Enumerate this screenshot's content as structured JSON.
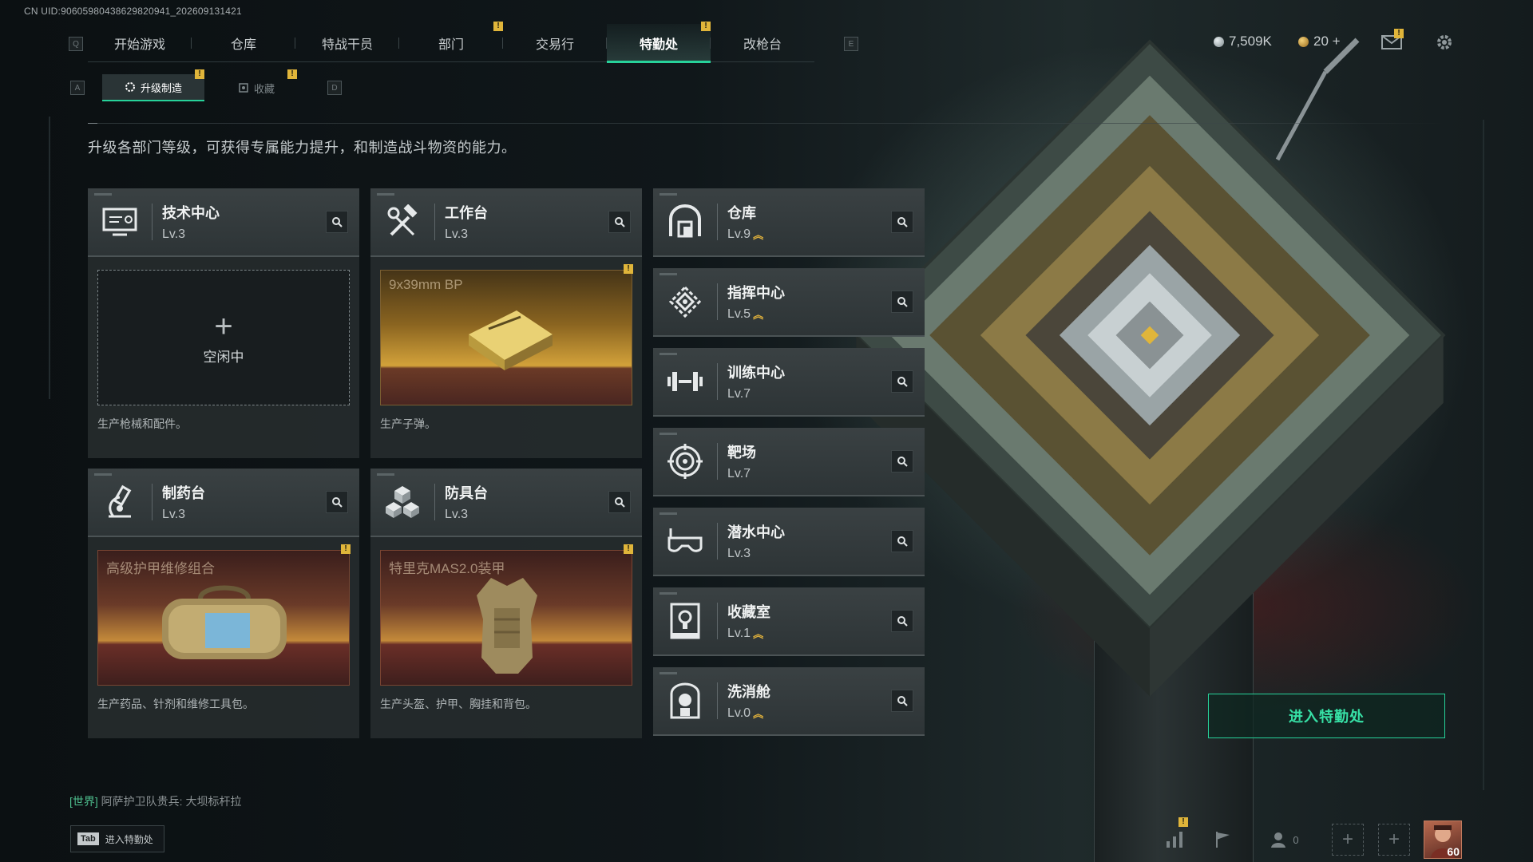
{
  "uid_text": "CN UID:9060598043862982094​1_202609131421",
  "nav": {
    "key_left": "Q",
    "key_right": "E",
    "tabs": [
      {
        "label": "开始游戏"
      },
      {
        "label": "仓库"
      },
      {
        "label": "特战干员"
      },
      {
        "label": "部门"
      },
      {
        "label": "交易行"
      },
      {
        "label": "特勤处"
      },
      {
        "label": "改枪台"
      }
    ],
    "active_tab": "特勤处"
  },
  "currency": {
    "silver": "7,509K",
    "gold": "20 +"
  },
  "subtabs": {
    "key_left": "A",
    "key_right": "D",
    "upgrade_label": "升级制造",
    "collect_label": "收藏"
  },
  "description": "升级各部门等级，可获得专属能力提升，和制造战斗物资的能力。",
  "workshops": [
    {
      "name": "技术中心",
      "level": "Lv.3",
      "icon": "computer-icon",
      "slot": {
        "state": "idle",
        "plus": "+",
        "label": "空闲中"
      },
      "caption": "生产枪械和配件。"
    },
    {
      "name": "工作台",
      "level": "Lv.3",
      "icon": "tools-icon",
      "slot": {
        "state": "producing",
        "item": "9x39mm BP"
      },
      "caption": "生产子弹。"
    },
    {
      "name": "制药台",
      "level": "Lv.3",
      "icon": "microscope-icon",
      "slot": {
        "state": "producing",
        "item": "高级护甲维修组合"
      },
      "caption": "生产药品、针剂和维修工具包。"
    },
    {
      "name": "防具台",
      "level": "Lv.3",
      "icon": "cubes-icon",
      "slot": {
        "state": "producing",
        "item": "特里克MAS2.0装甲"
      },
      "caption": "生产头盔、护甲、胸挂和背包。"
    }
  ],
  "departments": [
    {
      "name": "仓库",
      "level": "Lv.9",
      "upgradable": true,
      "icon": "vault-icon"
    },
    {
      "name": "指挥中心",
      "level": "Lv.5",
      "upgradable": true,
      "icon": "command-icon"
    },
    {
      "name": "训练中心",
      "level": "Lv.7",
      "upgradable": false,
      "icon": "dumbbell-icon"
    },
    {
      "name": "靶场",
      "level": "Lv.7",
      "upgradable": false,
      "icon": "target-icon"
    },
    {
      "name": "潜水中心",
      "level": "Lv.3",
      "upgradable": false,
      "icon": "diving-mask-icon"
    },
    {
      "name": "收藏室",
      "level": "Lv.1",
      "upgradable": true,
      "icon": "trophy-case-icon"
    },
    {
      "name": "洗消舱",
      "level": "Lv.0",
      "upgradable": true,
      "icon": "hazmat-icon"
    }
  ],
  "upgrade_glyph": "︽",
  "alert_glyph": "!",
  "enter_button": "进入特勤处",
  "chat": {
    "channel": "[世界]",
    "message": "阿萨护卫队贵兵: 大坝标杆拉"
  },
  "tab_hint": {
    "key": "Tab",
    "label": "进入特勤处"
  },
  "social": {
    "friends_count": "0"
  },
  "player": {
    "level": "60"
  },
  "colors": {
    "accent": "#27d29a",
    "alert": "#e0b53a",
    "upgrade": "#e3b33c"
  }
}
